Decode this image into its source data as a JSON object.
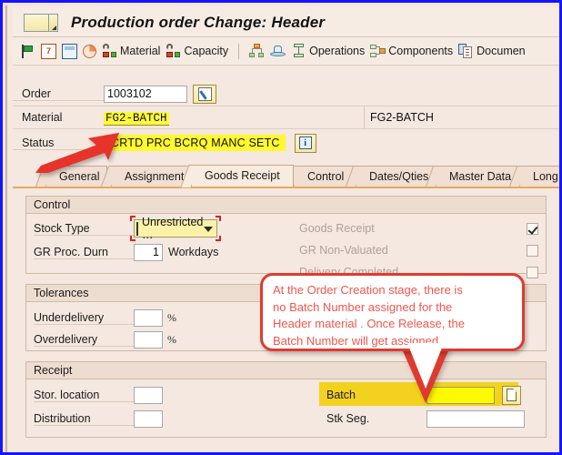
{
  "window": {
    "title": "Production order Change: Header",
    "icon": "sap-window-icon"
  },
  "toolbar": {
    "items": [
      {
        "label": "",
        "icon": "green-flag-icon"
      },
      {
        "label": "",
        "icon": "document-7-icon"
      },
      {
        "label": "",
        "icon": "calculator-icon"
      },
      {
        "label": "",
        "icon": "pie-chart-icon"
      },
      {
        "label": "Material",
        "icon": "material-icon"
      },
      {
        "label": "Capacity",
        "icon": "capacity-icon"
      },
      {
        "label": "",
        "icon": "network-icon"
      },
      {
        "label": "",
        "icon": "hat-icon"
      },
      {
        "label": "Operations",
        "icon": "operations-icon"
      },
      {
        "label": "Components",
        "icon": "components-icon"
      },
      {
        "label": "Documen",
        "icon": "documents-icon"
      }
    ]
  },
  "header": {
    "order_label": "Order",
    "order_value": "1003102",
    "order_edit_icon": "pencil-icon",
    "material_label": "Material",
    "material_value": "FG2-BATCH",
    "material_description": "FG2-BATCH",
    "status_label": "Status",
    "status_value": "CRTD PRC  BCRQ MANC SETC",
    "status_info_icon": "info-icon"
  },
  "tabs": {
    "active": "Goods Receipt",
    "items": [
      {
        "label": "General"
      },
      {
        "label": "Assignment"
      },
      {
        "label": "Goods Receipt"
      },
      {
        "label": "Control"
      },
      {
        "label": "Dates/Qties"
      },
      {
        "label": "Master Data"
      },
      {
        "label": "Long Te"
      }
    ]
  },
  "control_group": {
    "title": "Control",
    "stock_type_label": "Stock Type",
    "stock_type_value": "Unrestricted …",
    "gr_proc_durn_label": "GR Proc. Durn",
    "gr_proc_durn_value": "1",
    "gr_proc_durn_unit": "Workdays",
    "goods_receipt_label": "Goods Receipt",
    "goods_receipt_checked": true,
    "gr_non_valuated_label": "GR Non-Valuated",
    "gr_non_valuated_checked": false,
    "delivery_completed_label": "Delivery Completed",
    "delivery_completed_checked": false
  },
  "tolerances_group": {
    "title": "Tolerances",
    "underdelivery_label": "Underdelivery",
    "underdelivery_value": "",
    "underdelivery_unit": "%",
    "overdelivery_label": "Overdelivery",
    "overdelivery_value": "",
    "overdelivery_unit": "%"
  },
  "receipt_group": {
    "title": "Receipt",
    "stor_location_label": "Stor. location",
    "stor_location_value": "",
    "distribution_label": "Distribution",
    "distribution_value": "",
    "batch_label": "Batch",
    "batch_value": "",
    "batch_doc_icon": "document-icon",
    "stk_seg_label": "Stk Seg.",
    "stk_seg_value": ""
  },
  "annotation": {
    "line1": "At the Order Creation stage, there is",
    "line2": "no Batch Number assigned for the",
    "line3": "Header material . Once Release, the",
    "line4": "Batch Number will get assigned",
    "color": "#f2564c",
    "border_color": "#e03a30",
    "arrow_icon": "red-arrow-icon"
  },
  "colors": {
    "frame_blue": "#1414ff",
    "sap_background": "#f4e8e0",
    "highlight_yellow": "#fffa3c",
    "batch_highlight": "#f2d21e",
    "tab_active": "#f7ecdf",
    "accent_orange": "#e8a85f"
  }
}
